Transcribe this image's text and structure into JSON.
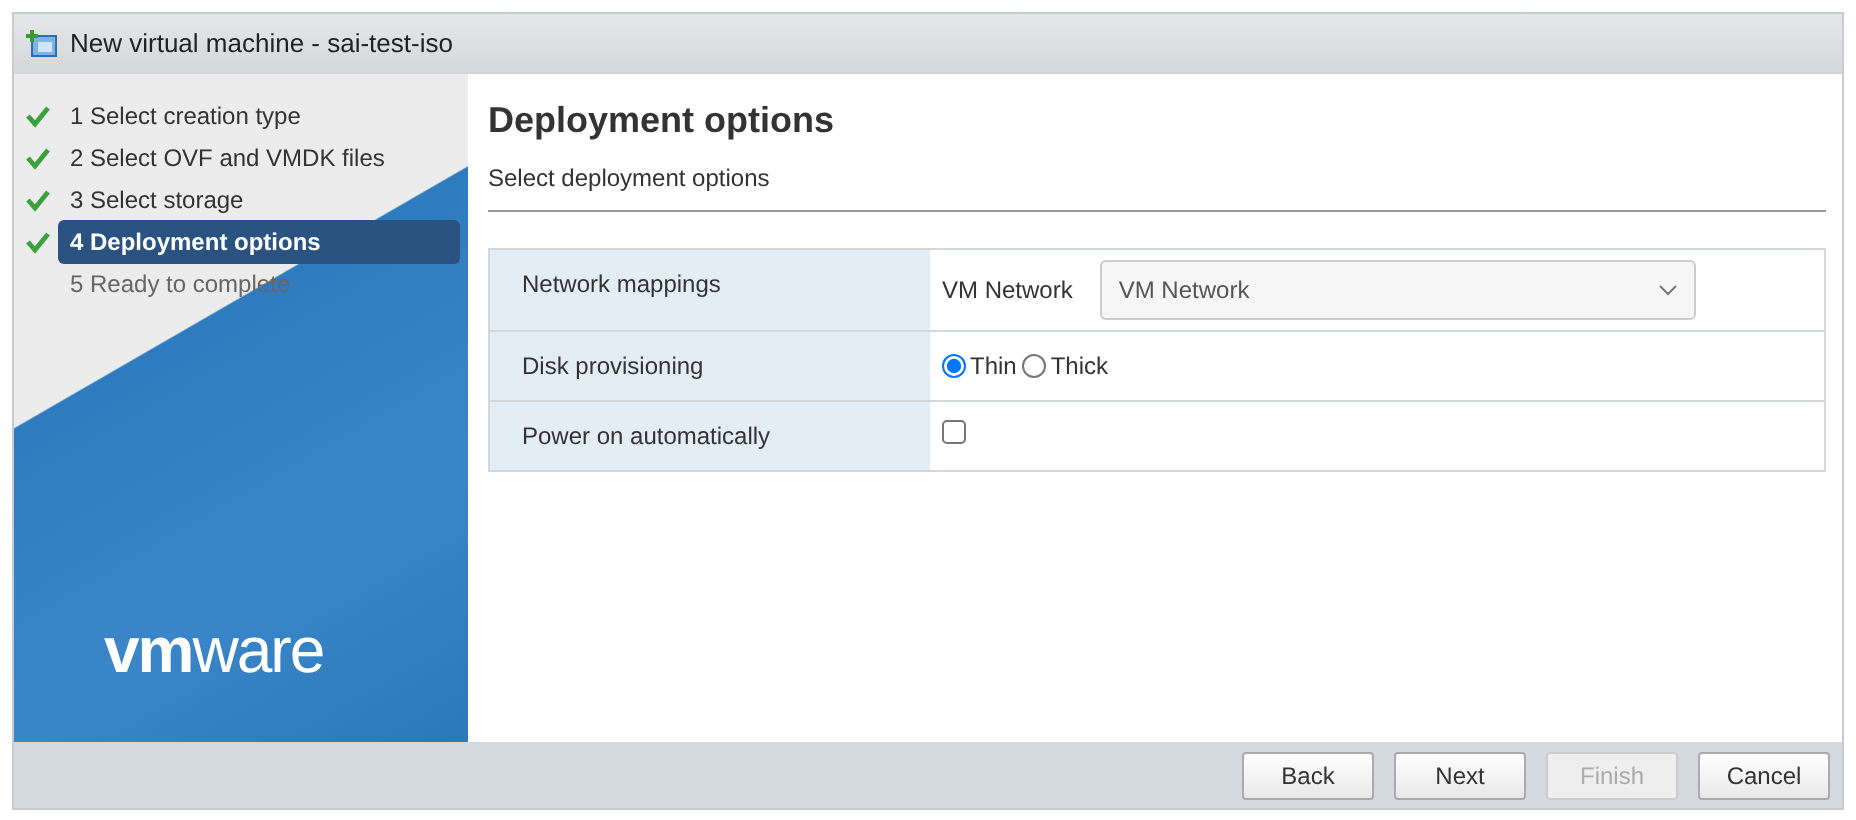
{
  "window": {
    "title": "New virtual machine - sai-test-iso"
  },
  "steps": [
    {
      "label": "1 Select creation type",
      "done": true,
      "selected": false
    },
    {
      "label": "2 Select OVF and VMDK files",
      "done": true,
      "selected": false
    },
    {
      "label": "3 Select storage",
      "done": true,
      "selected": false
    },
    {
      "label": "4 Deployment options",
      "done": true,
      "selected": true
    },
    {
      "label": "5 Ready to complete",
      "done": false,
      "selected": false
    }
  ],
  "logo": "**vm**ware",
  "page": {
    "title": "Deployment options",
    "subtitle": "Select deployment options"
  },
  "options": [
    {
      "kind": "select",
      "label": "Network mappings",
      "field_label": "VM Network",
      "value": "VM Network"
    },
    {
      "kind": "radio",
      "label": "Disk provisioning",
      "choices": [
        {
          "label": "Thin",
          "selected": true
        },
        {
          "label": "Thick",
          "selected": false
        }
      ]
    },
    {
      "kind": "checkbox",
      "label": "Power on automatically",
      "checked": false
    }
  ],
  "buttons": [
    {
      "label": "Back",
      "disabled": false
    },
    {
      "label": "Next",
      "disabled": false
    },
    {
      "label": "Finish",
      "disabled": true
    },
    {
      "label": "Cancel",
      "disabled": false
    }
  ]
}
